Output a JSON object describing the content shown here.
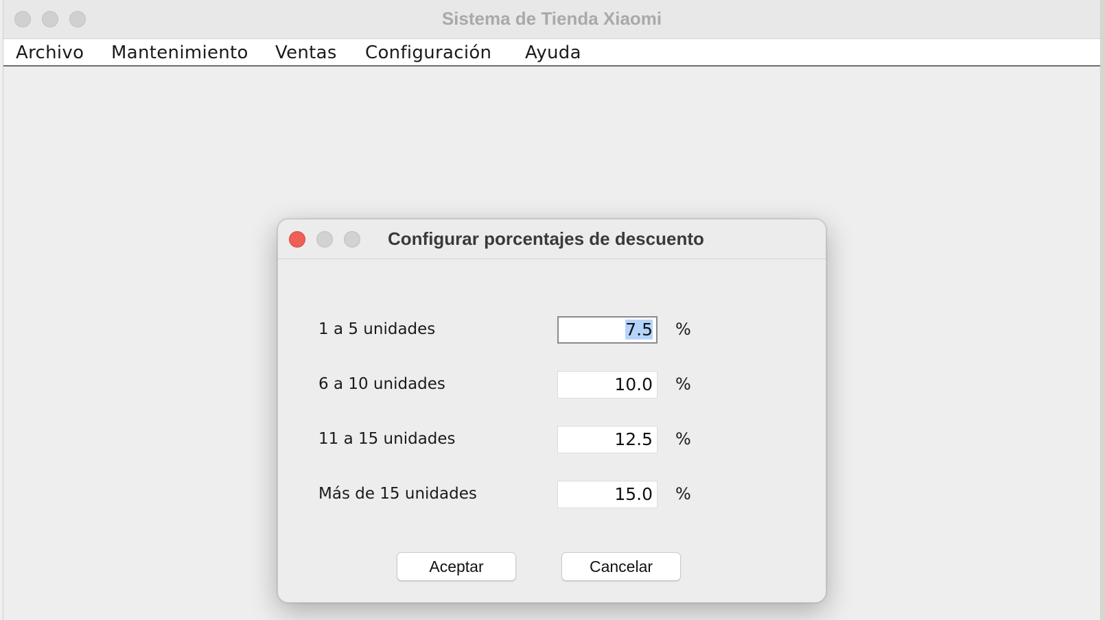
{
  "main_window": {
    "title": "Sistema de Tienda Xiaomi",
    "menu": [
      "Archivo",
      "Mantenimiento",
      "Ventas",
      "Configuración",
      "Ayuda"
    ]
  },
  "dialog": {
    "title": "Configurar porcentajes de descuento",
    "rows": [
      {
        "label": "1 a 5 unidades",
        "value": "7.5",
        "unit": "%"
      },
      {
        "label": "6 a 10 unidades",
        "value": "10.0",
        "unit": "%"
      },
      {
        "label": "11 a 15 unidades",
        "value": "12.5",
        "unit": "%"
      },
      {
        "label": "Más de 15 unidades",
        "value": "15.0",
        "unit": "%"
      }
    ],
    "buttons": {
      "accept": "Aceptar",
      "cancel": "Cancelar"
    }
  },
  "colors": {
    "close_button": "#ee5f56",
    "selection_highlight": "#b3d3fb"
  }
}
